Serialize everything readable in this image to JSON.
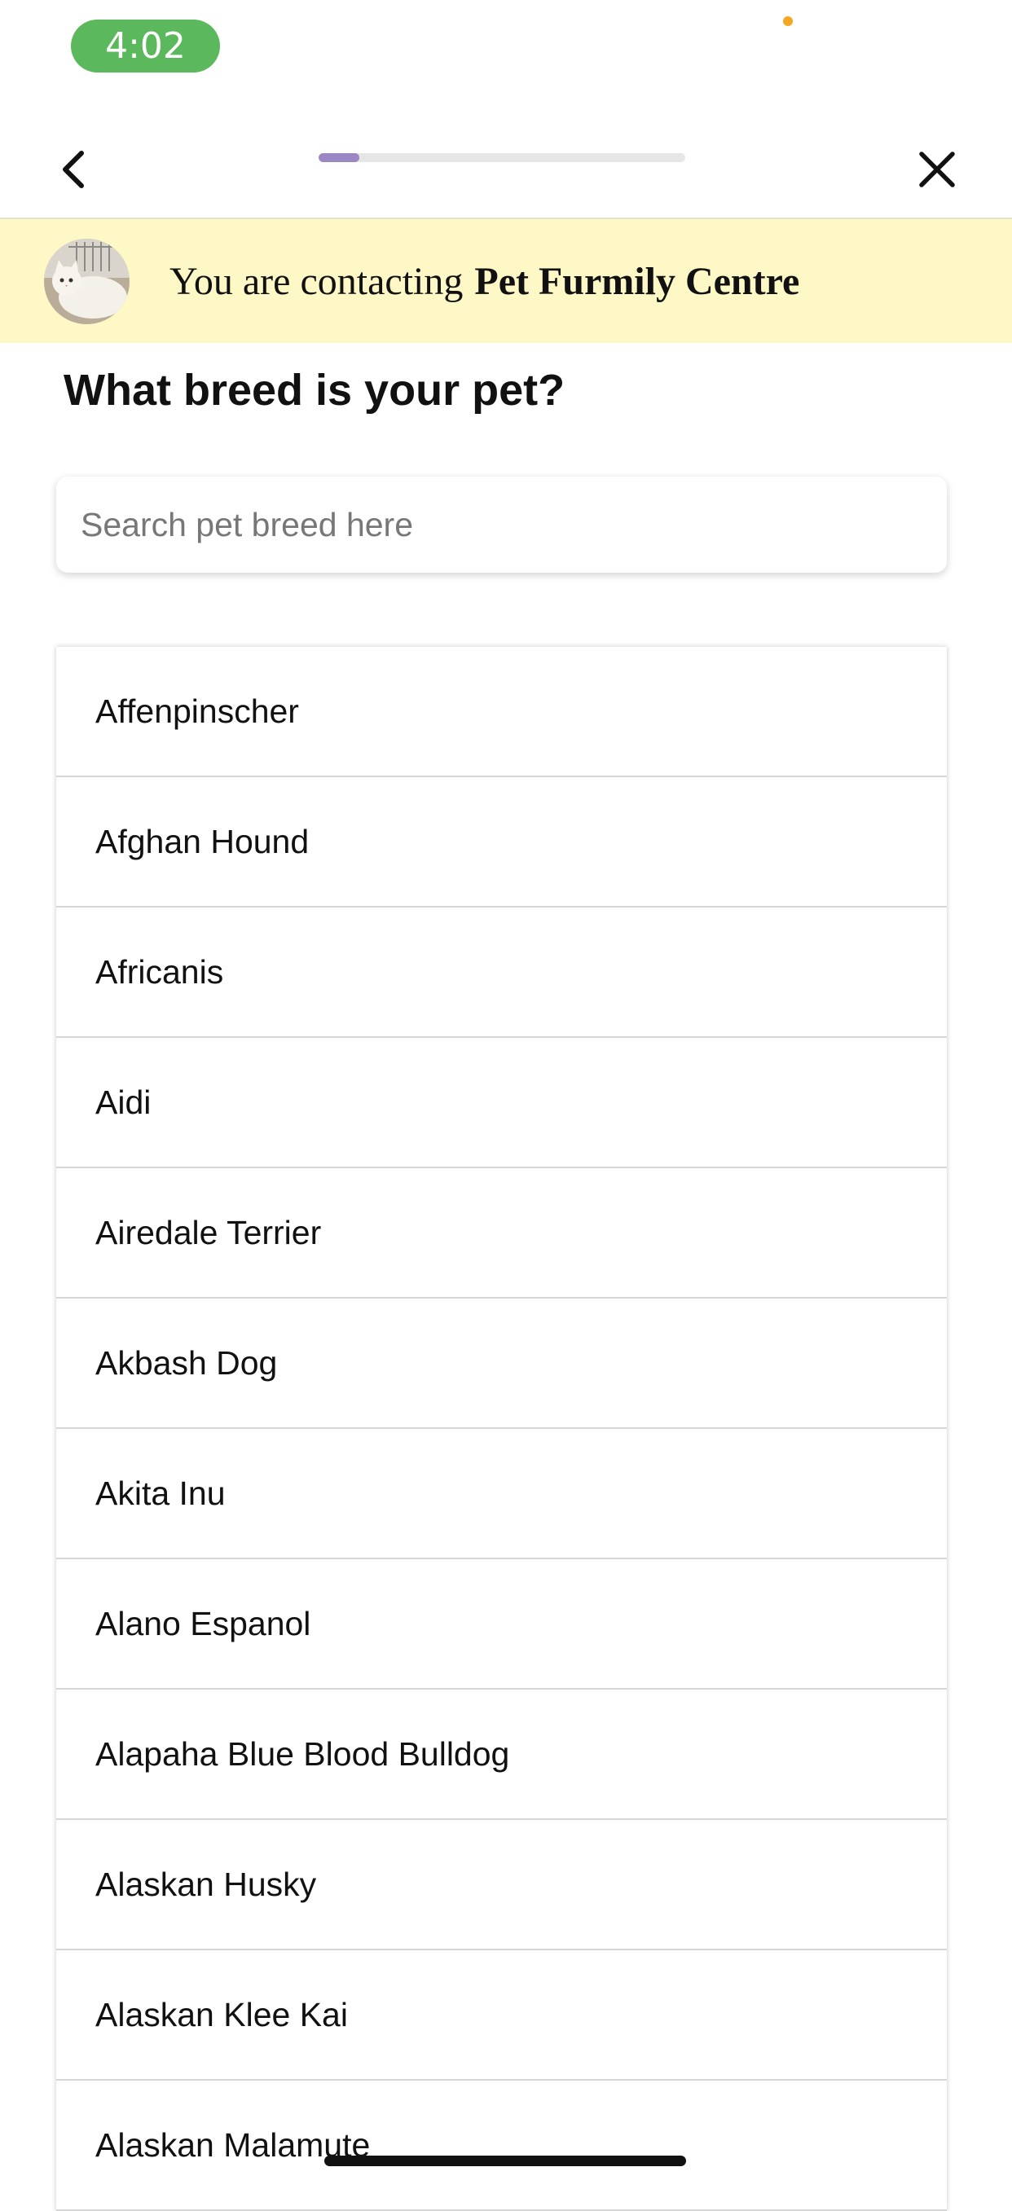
{
  "status_bar": {
    "time": "4:02",
    "time_pill_color": "#5cb85c"
  },
  "nav": {
    "back_icon": "chevron-left-icon",
    "close_icon": "close-icon",
    "progress": 0.11,
    "progress_color": "#9b87c4"
  },
  "banner": {
    "prefix": "You are contacting",
    "clinic_name": "Pet Furmily Centre",
    "background": "#fdf8c6"
  },
  "question": {
    "title": "What breed is your pet?"
  },
  "search": {
    "placeholder": "Search pet breed here",
    "value": ""
  },
  "breeds": [
    "Affenpinscher",
    "Afghan Hound",
    "Africanis",
    "Aidi",
    "Airedale Terrier",
    "Akbash Dog",
    "Akita Inu",
    "Alano Espanol",
    "Alapaha Blue Blood Bulldog",
    "Alaskan Husky",
    "Alaskan Klee Kai",
    "Alaskan Malamute"
  ]
}
